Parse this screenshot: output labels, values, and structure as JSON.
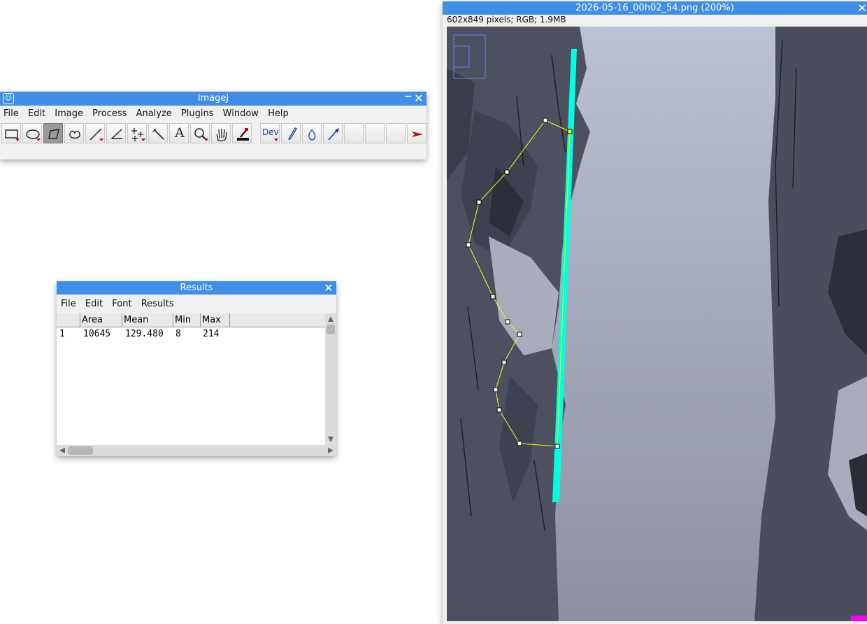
{
  "imagej": {
    "title": "ImageJ",
    "menu": [
      "File",
      "Edit",
      "Image",
      "Process",
      "Analyze",
      "Plugins",
      "Window",
      "Help"
    ],
    "tools": [
      "rectangle-tool",
      "oval-tool",
      "polygon-tool",
      "freehand-tool",
      "line-tool",
      "angle-tool",
      "multipoint-tool",
      "wand-tool",
      "text-tool",
      "magnifier-tool",
      "hand-tool",
      "color-picker-tool",
      "dev-tool",
      "brush-tool",
      "flood-fill-tool",
      "arrow-tool",
      "empty-slot",
      "empty-slot",
      "empty-slot",
      "more-tools"
    ],
    "dev_label": "Dev",
    "text_tool_label": "A"
  },
  "results": {
    "title": "Results",
    "menu": [
      "File",
      "Edit",
      "Font",
      "Results"
    ],
    "columns": [
      "",
      "Area",
      "Mean",
      "Min",
      "Max"
    ],
    "rows": [
      [
        "1",
        "10645",
        "129.480",
        "8",
        "214"
      ]
    ]
  },
  "image_window": {
    "title": "2026-05-16_00h02_54.png (200%)",
    "info": "602x849 pixels; RGB; 1.9MB"
  },
  "colors": {
    "titlebar": "#3f8fe9",
    "selection": "#ffff00",
    "line_roi": "#00ffe0",
    "selected_tool": "#9a9a9a"
  }
}
